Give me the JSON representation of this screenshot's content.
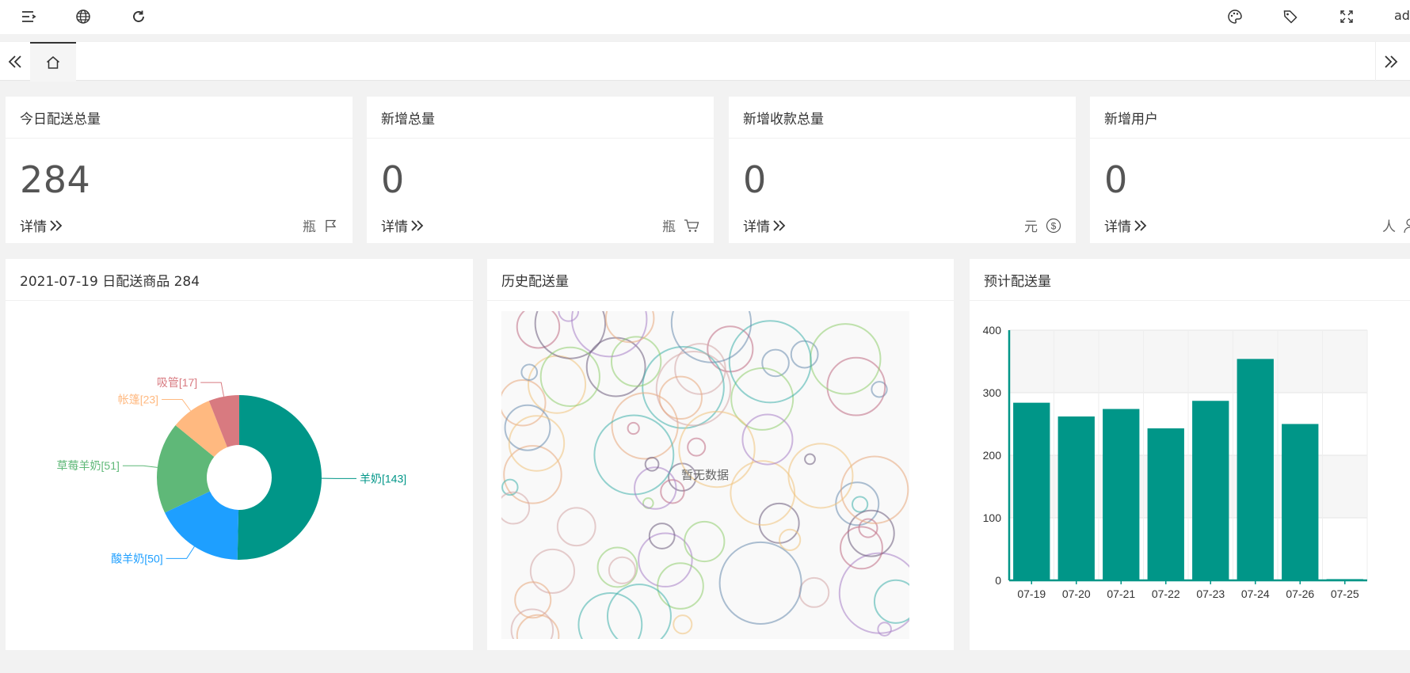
{
  "header": {
    "user": "ad",
    "icons": [
      "menu-icon",
      "globe-icon",
      "refresh-icon",
      "palette-icon",
      "tag-icon",
      "fullscreen-icon"
    ]
  },
  "tabs": {
    "home_icon": "home-icon"
  },
  "stats": [
    {
      "title": "今日配送总量",
      "value": "284",
      "link": "详情",
      "unit": "瓶",
      "icon": "flag-icon"
    },
    {
      "title": "新增总量",
      "value": "0",
      "link": "详情",
      "unit": "瓶",
      "icon": "cart-icon"
    },
    {
      "title": "新增收款总量",
      "value": "0",
      "link": "详情",
      "unit": "元",
      "icon": "dollar-icon"
    },
    {
      "title": "新增用户",
      "value": "0",
      "link": "详情",
      "unit": "人",
      "icon": "user-icon"
    }
  ],
  "panels": {
    "pie_title": "2021-07-19 日配送商品 284",
    "history_title": "历史配送量",
    "history_empty": "暂无数据",
    "bar_title": "预计配送量"
  },
  "colors": {
    "teal": "#009688",
    "blue": "#1e9fff",
    "green": "#5fb878",
    "orange": "#ffb980",
    "red": "#d87a80"
  },
  "chart_data": [
    {
      "type": "pie",
      "title": "2021-07-19 日配送商品 284",
      "slices": [
        {
          "name": "羊奶",
          "value": 143,
          "label": "羊奶[143]",
          "color": "#009688"
        },
        {
          "name": "酸羊奶",
          "value": 50,
          "label": "酸羊奶[50]",
          "color": "#1e9fff"
        },
        {
          "name": "草莓羊奶",
          "value": 51,
          "label": "草莓羊奶[51]",
          "color": "#5fb878"
        },
        {
          "name": "帐篷",
          "value": 23,
          "label": "帐篷[23]",
          "color": "#ffb980"
        },
        {
          "name": "吸管",
          "value": 17,
          "label": "吸管[17]",
          "color": "#d87a80"
        }
      ]
    },
    {
      "type": "bar",
      "title": "预计配送量",
      "categories": [
        "07-19",
        "07-20",
        "07-21",
        "07-22",
        "07-23",
        "07-24",
        "07-26",
        "07-25"
      ],
      "values": [
        284,
        262,
        274,
        243,
        287,
        354,
        250,
        2
      ],
      "ylim": [
        0,
        400
      ],
      "yticks": [
        "0",
        "100",
        "200",
        "300",
        "400"
      ],
      "color": "#009688",
      "grid": true
    }
  ]
}
